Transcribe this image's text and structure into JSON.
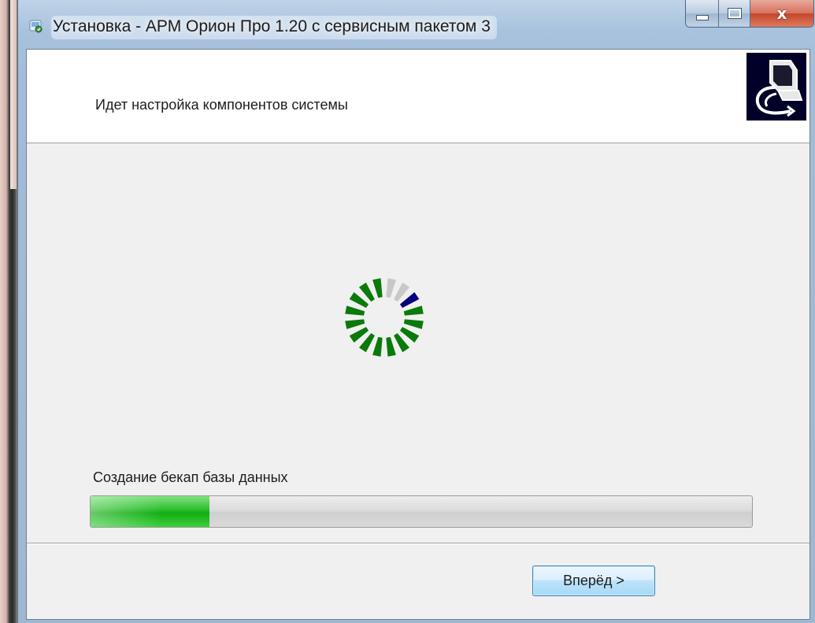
{
  "window": {
    "title": "Установка - АРМ Орион Про 1.20 с сервисным пакетом 3",
    "icon": "installer-icon"
  },
  "caption": {
    "minimize_icon": "minimize-icon",
    "maximize_icon": "maximize-icon",
    "close_label": "x"
  },
  "header": {
    "text": "Идет настройка компонентов системы",
    "logo_icon": "computer-logo-icon"
  },
  "spinner": {
    "icon": "loading-spinner-icon",
    "segments": 16,
    "colors": {
      "done": "#0a7a0a",
      "active": "#00007f",
      "pending": "#c8c8c8"
    }
  },
  "status": {
    "text": "Создание бекап базы данных"
  },
  "progress": {
    "value": 0.18,
    "color": "#1cb51c"
  },
  "buttons": {
    "next_label": "Вперёд >"
  }
}
